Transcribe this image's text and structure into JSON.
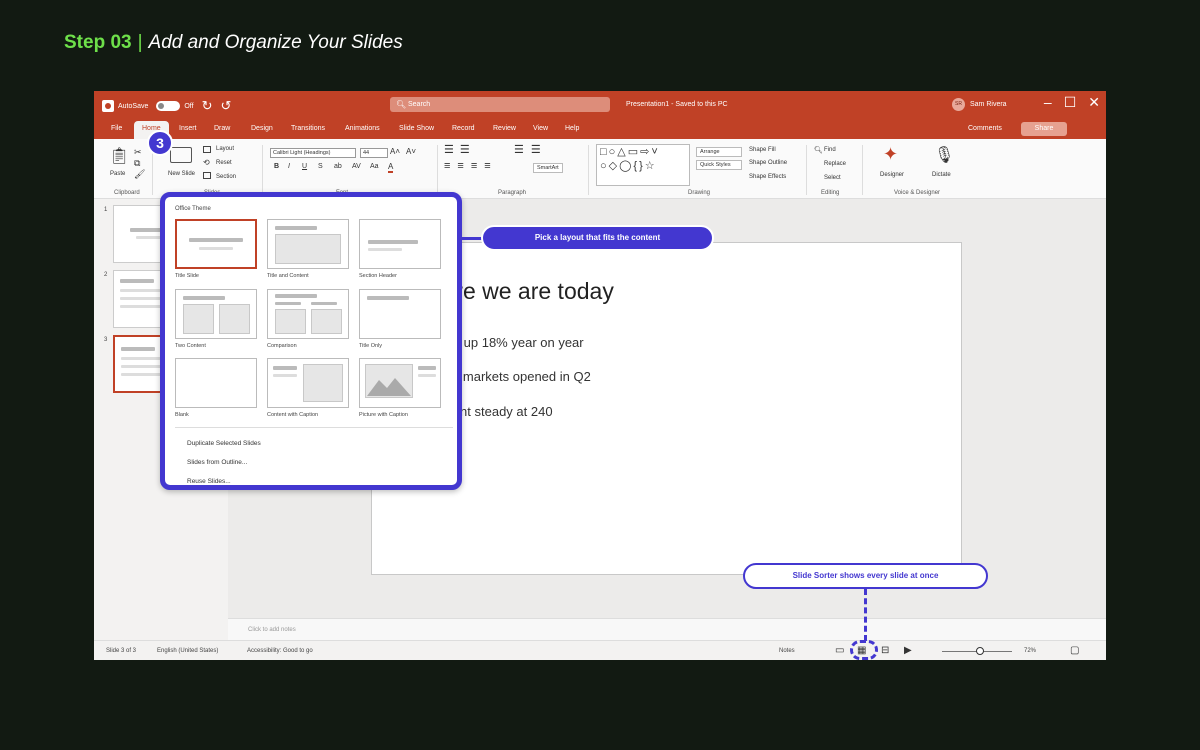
{
  "step": {
    "number": "Step 03",
    "separator": "|",
    "title": "Add and Organize Your Slides"
  },
  "titlebar": {
    "autosave_label": "AutoSave",
    "autosave_state": "Off",
    "search_placeholder": "Search",
    "document_title": "Presentation1 - Saved to this PC",
    "user_initials": "SR",
    "user_name": "Sam Rivera"
  },
  "tabs": [
    {
      "label": "File"
    },
    {
      "label": "Home"
    },
    {
      "label": "Insert"
    },
    {
      "label": "Draw"
    },
    {
      "label": "Design"
    },
    {
      "label": "Transitions"
    },
    {
      "label": "Animations"
    },
    {
      "label": "Slide Show"
    },
    {
      "label": "Record"
    },
    {
      "label": "Review"
    },
    {
      "label": "View"
    },
    {
      "label": "Help"
    }
  ],
  "tab_actions": {
    "comments": "Comments",
    "share": "Share"
  },
  "ribbon": {
    "clipboard": {
      "paste": "Paste",
      "group": "Clipboard"
    },
    "slides": {
      "new_slide": "New Slide",
      "layout": "Layout",
      "reset": "Reset",
      "section": "Section",
      "group": "Slides"
    },
    "font": {
      "family": "Calibri Light (Headings)",
      "size": "44",
      "bold": "B",
      "italic": "I",
      "underline": "U",
      "strike": "S",
      "small_caps": "ab",
      "spacing": "AV",
      "case": "Aa",
      "color": "A",
      "group": "Font"
    },
    "paragraph": {
      "smartart": "SmartArt",
      "group": "Paragraph"
    },
    "drawing": {
      "arrange": "Arrange",
      "quick_styles": "Quick Styles",
      "shape_fill": "Shape Fill",
      "shape_outline": "Shape Outline",
      "shape_effects": "Shape Effects",
      "group": "Drawing"
    },
    "editing": {
      "find": "Find",
      "replace": "Replace",
      "select": "Select",
      "group": "Editing"
    },
    "voice": {
      "designer": "Designer",
      "dictate": "Dictate",
      "group": "Voice & Designer"
    }
  },
  "thumbnails": [
    {
      "num": "1"
    },
    {
      "num": "2"
    },
    {
      "num": "3"
    }
  ],
  "slide": {
    "title": "Where we are today",
    "bullets": [
      "Revenue up 18% year on year",
      "Two new markets opened in Q2",
      "Headcount steady at 240"
    ]
  },
  "notes_placeholder": "Click to add notes",
  "dropdown": {
    "heading": "Office Theme",
    "layouts": [
      {
        "label": "Title Slide"
      },
      {
        "label": "Title and Content"
      },
      {
        "label": "Section Header"
      },
      {
        "label": "Two Content"
      },
      {
        "label": "Comparison"
      },
      {
        "label": "Title Only"
      },
      {
        "label": "Blank"
      },
      {
        "label": "Content with Caption"
      },
      {
        "label": "Picture with Caption"
      }
    ],
    "actions": [
      {
        "label": "Duplicate Selected Slides"
      },
      {
        "label": "Slides from Outline..."
      },
      {
        "label": "Reuse Slides..."
      }
    ]
  },
  "statusbar": {
    "slide_count": "Slide 3 of 3",
    "language": "English (United States)",
    "accessibility": "Accessibility: Good to go",
    "notes": "Notes",
    "zoom": "72%"
  },
  "callouts": {
    "badge": "3",
    "layout_tip": "Pick a layout that fits the content",
    "sorter_tip": "Slide Sorter shows every slide at once"
  },
  "icons": {
    "app": "powerpoint-icon",
    "undo": "undo-icon",
    "redo": "redo-icon",
    "search": "search-icon",
    "minimize": "minimize-icon",
    "maximize": "maximize-icon",
    "close": "close-icon",
    "paste": "clipboard-icon",
    "cut": "scissors-icon",
    "copy": "copy-icon",
    "format_painter": "brush-icon",
    "designer": "sparkle-icon",
    "dictate": "microphone-icon",
    "normal_view": "normal-view-icon",
    "sorter_view": "slide-sorter-icon",
    "reading_view": "reading-view-icon",
    "slideshow": "play-icon",
    "fit": "fit-slide-icon"
  },
  "colors": {
    "accent": "#c04126",
    "callout": "#4337d0",
    "step_green": "#6ee04a",
    "background": "#121a12"
  }
}
